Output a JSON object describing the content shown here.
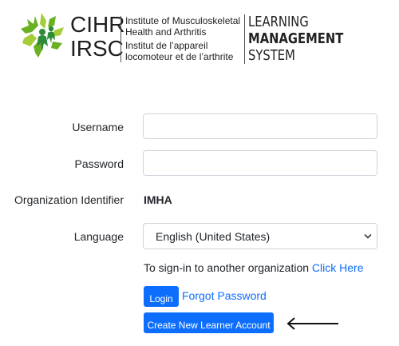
{
  "header": {
    "acronym_en": "CIHR",
    "acronym_fr": "IRSC",
    "institute_en_line1": "Institute of Musculoskeletal",
    "institute_en_line2": "Health and Arthritis",
    "institute_fr_line1": "Institut de l’appareil",
    "institute_fr_line2": "locomoteur et de l’arthrite",
    "lms_line1": "LEARNING",
    "lms_line2": "MANAGEMENT",
    "lms_line3": "SYSTEM",
    "logo_icon": "maple-leaf-people-icon",
    "logo_colors": [
      "#6ab023",
      "#2e8b3a",
      "#a5cd39"
    ]
  },
  "form": {
    "username_label": "Username",
    "username_value": "",
    "password_label": "Password",
    "password_value": "",
    "org_label": "Organization Identifier",
    "org_value": "IMHA",
    "language_label": "Language",
    "language_selected": "English (United States)",
    "signin_text": "To sign-in to another organization",
    "click_here_label": "Click Here",
    "login_label": "Login",
    "forgot_label": "Forgot Password",
    "create_account_label": "Create New Learner Account"
  },
  "annotation": {
    "icon": "arrow-left-icon"
  },
  "colors": {
    "primary": "#0d6efd",
    "text": "#212529",
    "border": "#ced4da"
  }
}
